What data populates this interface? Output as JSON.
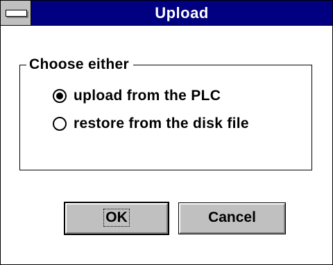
{
  "window": {
    "title": "Upload"
  },
  "group": {
    "label": "Choose either",
    "options": [
      {
        "label": "upload from the PLC",
        "selected": true
      },
      {
        "label": "restore from the disk file",
        "selected": false
      }
    ]
  },
  "buttons": {
    "ok_label": "OK",
    "cancel_label": "Cancel"
  },
  "colors": {
    "titlebar": "#000080",
    "button_face": "#c0c0c0"
  },
  "icons": {
    "system_menu": "system-menu-icon"
  }
}
